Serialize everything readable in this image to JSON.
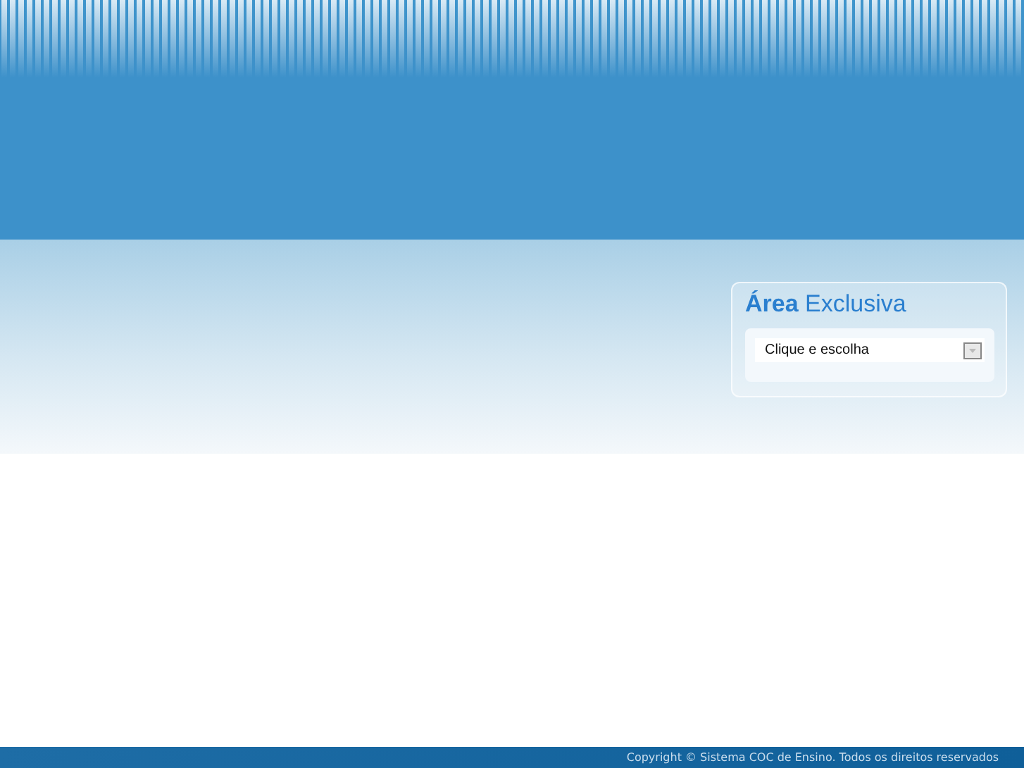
{
  "exclusive_area": {
    "title": "**Área** Exclusiva",
    "dropdown": {
      "value": "Clique e escolha"
    }
  },
  "footer": {
    "copyright": "Copyright © Sistema COC de Ensino. Todos os direitos reservados"
  }
}
